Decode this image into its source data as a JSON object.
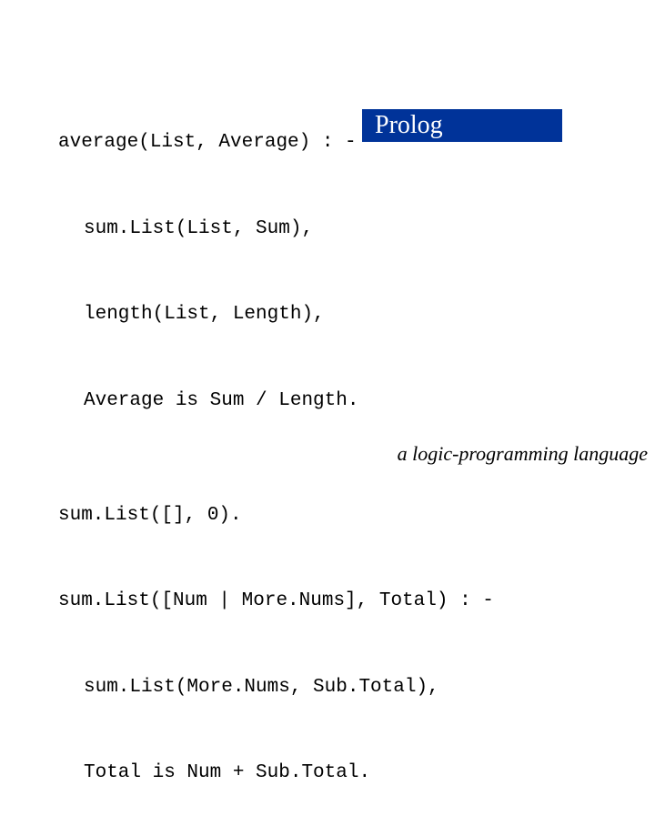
{
  "code": {
    "line1": "average(List, Average) : -",
    "line2_indent": "sum.List(List, Sum),",
    "line3_indent": "length(List, Length),",
    "line4_indent": "Average is Sum / Length.",
    "line6": "sum.List([], 0).",
    "line7": "sum.List([Num | More.Nums], Total) : -",
    "line8_indent": "sum.List(More.Nums, Sub.Total),",
    "line9_indent": "Total is Num + Sub.Total."
  },
  "badge": {
    "label": "Prolog"
  },
  "footer": {
    "text": "a logic-programming language"
  }
}
